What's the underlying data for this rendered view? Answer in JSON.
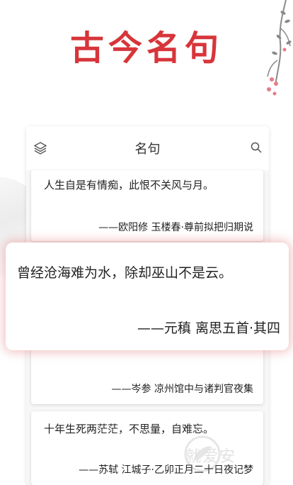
{
  "header": {
    "title": "古今名句"
  },
  "panel": {
    "title": "名句",
    "left_icon": "layers-icon",
    "right_icon": "search-icon"
  },
  "quotes": [
    {
      "text": "人生自是有情痴，此恨不关风与月。",
      "source": "——欧阳修  玉楼春·尊前拟把归期说"
    },
    {
      "text": "曾经沧海难为水，除却巫山不是云。",
      "source": "——元稹  离思五首·其四",
      "highlighted": true
    },
    {
      "text": "",
      "source": "——岑参  凉州馆中与诸判官夜集"
    },
    {
      "text": "十年生死两茫茫，不思量，自难忘。",
      "source": "——苏轼  江城子·乙卯正月二十日夜记梦"
    }
  ],
  "watermark": {
    "text": "就爱安",
    "icon": "bird-logo-icon"
  },
  "colors": {
    "title_red": "#d7353a",
    "glow": "#e27878"
  }
}
